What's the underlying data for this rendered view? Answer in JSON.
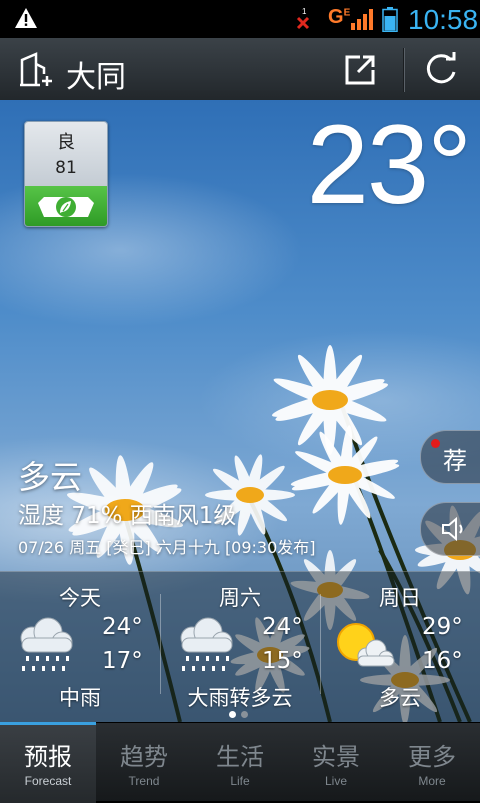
{
  "status_bar": {
    "network": "G",
    "network_sup": "E",
    "sim_slot": "1",
    "time": "10:58"
  },
  "header": {
    "city": "大同"
  },
  "air_quality": {
    "level": "良",
    "value": "81",
    "color": "#3fae33"
  },
  "current": {
    "temperature": "23°",
    "condition": "多云",
    "humidity_wind": "湿度 71% 西南风1级",
    "date_line": "07/26 周五  [癸巳] 六月十九  [09:30发布]"
  },
  "side_buttons": {
    "recommend": "荐"
  },
  "forecast": [
    {
      "day": "今天",
      "high": "24°",
      "low": "17°",
      "condition": "中雨",
      "icon": "rain-cloud-icon"
    },
    {
      "day": "周六",
      "high": "24°",
      "low": "15°",
      "condition": "大雨转多云",
      "icon": "rain-cloud-icon"
    },
    {
      "day": "周日",
      "high": "29°",
      "low": "16°",
      "condition": "多云",
      "icon": "sun-cloud-icon"
    }
  ],
  "pager": {
    "pages": 2,
    "current": 1
  },
  "tabs": [
    {
      "cn": "预报",
      "en": "Forecast",
      "active": true
    },
    {
      "cn": "趋势",
      "en": "Trend",
      "active": false
    },
    {
      "cn": "生活",
      "en": "Life",
      "active": false
    },
    {
      "cn": "实景",
      "en": "Live",
      "active": false
    },
    {
      "cn": "更多",
      "en": "More",
      "active": false
    }
  ],
  "colors": {
    "accent": "#3aa0e0",
    "time": "#3ab4f2",
    "network": "#ff7a2a"
  }
}
